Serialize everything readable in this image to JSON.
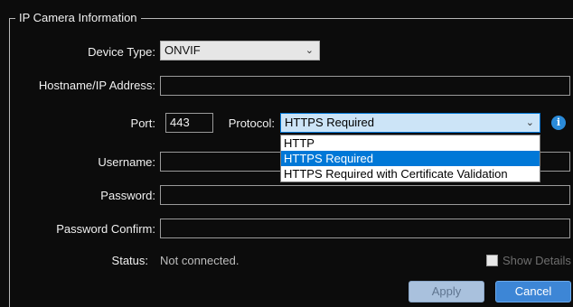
{
  "group": {
    "title": "IP Camera Information"
  },
  "device_type": {
    "label": "Device Type:",
    "value": "ONVIF",
    "chevron": "chevron-down-icon"
  },
  "hostname": {
    "label": "Hostname/IP Address:",
    "value": ""
  },
  "port": {
    "label": "Port:",
    "value": "443"
  },
  "protocol": {
    "label": "Protocol:",
    "value": "HTTPS Required",
    "chevron": "chevron-down-icon",
    "options": [
      "HTTP",
      "HTTPS Required",
      "HTTPS Required with Certificate Validation"
    ],
    "selected_index": 1
  },
  "info_icon": {
    "glyph": "i",
    "color": "#2b8bd9"
  },
  "username": {
    "label": "Username:",
    "value": ""
  },
  "password": {
    "label": "Password:",
    "value": ""
  },
  "password_confirm": {
    "label": "Password Confirm:",
    "value": ""
  },
  "status": {
    "label": "Status:",
    "value": "Not connected."
  },
  "show_details": {
    "label": "Show Details",
    "checked": false
  },
  "buttons": {
    "apply": "Apply",
    "cancel": "Cancel"
  },
  "colors": {
    "background": "#0c0c0c",
    "accent": "#0078d7",
    "cancel": "#3d86d6"
  }
}
